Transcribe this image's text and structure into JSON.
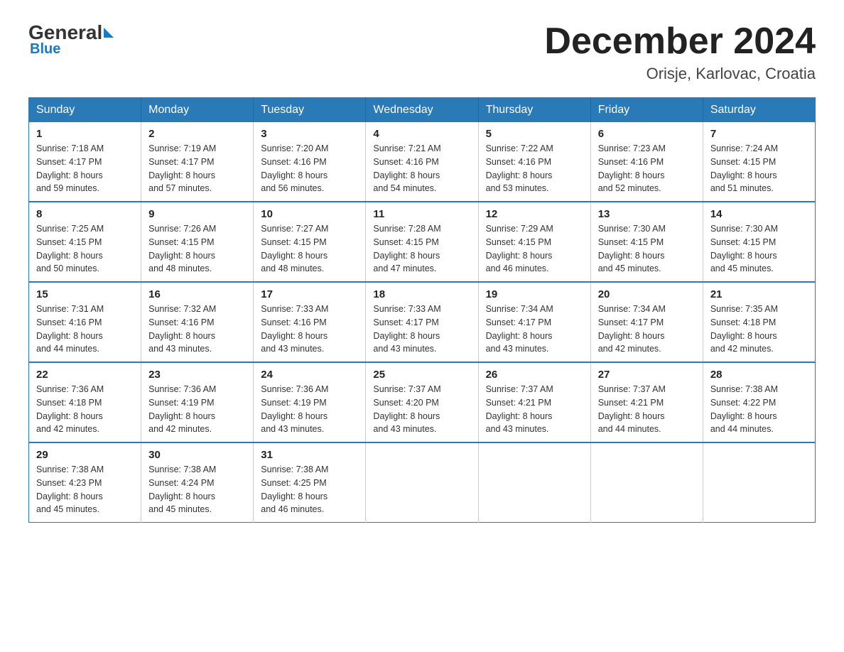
{
  "logo": {
    "general": "General",
    "blue": "Blue"
  },
  "header": {
    "month_year": "December 2024",
    "location": "Orisje, Karlovac, Croatia"
  },
  "weekdays": [
    "Sunday",
    "Monday",
    "Tuesday",
    "Wednesday",
    "Thursday",
    "Friday",
    "Saturday"
  ],
  "weeks": [
    [
      {
        "day": "1",
        "sunrise": "7:18 AM",
        "sunset": "4:17 PM",
        "daylight": "8 hours and 59 minutes."
      },
      {
        "day": "2",
        "sunrise": "7:19 AM",
        "sunset": "4:17 PM",
        "daylight": "8 hours and 57 minutes."
      },
      {
        "day": "3",
        "sunrise": "7:20 AM",
        "sunset": "4:16 PM",
        "daylight": "8 hours and 56 minutes."
      },
      {
        "day": "4",
        "sunrise": "7:21 AM",
        "sunset": "4:16 PM",
        "daylight": "8 hours and 54 minutes."
      },
      {
        "day": "5",
        "sunrise": "7:22 AM",
        "sunset": "4:16 PM",
        "daylight": "8 hours and 53 minutes."
      },
      {
        "day": "6",
        "sunrise": "7:23 AM",
        "sunset": "4:16 PM",
        "daylight": "8 hours and 52 minutes."
      },
      {
        "day": "7",
        "sunrise": "7:24 AM",
        "sunset": "4:15 PM",
        "daylight": "8 hours and 51 minutes."
      }
    ],
    [
      {
        "day": "8",
        "sunrise": "7:25 AM",
        "sunset": "4:15 PM",
        "daylight": "8 hours and 50 minutes."
      },
      {
        "day": "9",
        "sunrise": "7:26 AM",
        "sunset": "4:15 PM",
        "daylight": "8 hours and 48 minutes."
      },
      {
        "day": "10",
        "sunrise": "7:27 AM",
        "sunset": "4:15 PM",
        "daylight": "8 hours and 48 minutes."
      },
      {
        "day": "11",
        "sunrise": "7:28 AM",
        "sunset": "4:15 PM",
        "daylight": "8 hours and 47 minutes."
      },
      {
        "day": "12",
        "sunrise": "7:29 AM",
        "sunset": "4:15 PM",
        "daylight": "8 hours and 46 minutes."
      },
      {
        "day": "13",
        "sunrise": "7:30 AM",
        "sunset": "4:15 PM",
        "daylight": "8 hours and 45 minutes."
      },
      {
        "day": "14",
        "sunrise": "7:30 AM",
        "sunset": "4:15 PM",
        "daylight": "8 hours and 45 minutes."
      }
    ],
    [
      {
        "day": "15",
        "sunrise": "7:31 AM",
        "sunset": "4:16 PM",
        "daylight": "8 hours and 44 minutes."
      },
      {
        "day": "16",
        "sunrise": "7:32 AM",
        "sunset": "4:16 PM",
        "daylight": "8 hours and 43 minutes."
      },
      {
        "day": "17",
        "sunrise": "7:33 AM",
        "sunset": "4:16 PM",
        "daylight": "8 hours and 43 minutes."
      },
      {
        "day": "18",
        "sunrise": "7:33 AM",
        "sunset": "4:17 PM",
        "daylight": "8 hours and 43 minutes."
      },
      {
        "day": "19",
        "sunrise": "7:34 AM",
        "sunset": "4:17 PM",
        "daylight": "8 hours and 43 minutes."
      },
      {
        "day": "20",
        "sunrise": "7:34 AM",
        "sunset": "4:17 PM",
        "daylight": "8 hours and 42 minutes."
      },
      {
        "day": "21",
        "sunrise": "7:35 AM",
        "sunset": "4:18 PM",
        "daylight": "8 hours and 42 minutes."
      }
    ],
    [
      {
        "day": "22",
        "sunrise": "7:36 AM",
        "sunset": "4:18 PM",
        "daylight": "8 hours and 42 minutes."
      },
      {
        "day": "23",
        "sunrise": "7:36 AM",
        "sunset": "4:19 PM",
        "daylight": "8 hours and 42 minutes."
      },
      {
        "day": "24",
        "sunrise": "7:36 AM",
        "sunset": "4:19 PM",
        "daylight": "8 hours and 43 minutes."
      },
      {
        "day": "25",
        "sunrise": "7:37 AM",
        "sunset": "4:20 PM",
        "daylight": "8 hours and 43 minutes."
      },
      {
        "day": "26",
        "sunrise": "7:37 AM",
        "sunset": "4:21 PM",
        "daylight": "8 hours and 43 minutes."
      },
      {
        "day": "27",
        "sunrise": "7:37 AM",
        "sunset": "4:21 PM",
        "daylight": "8 hours and 44 minutes."
      },
      {
        "day": "28",
        "sunrise": "7:38 AM",
        "sunset": "4:22 PM",
        "daylight": "8 hours and 44 minutes."
      }
    ],
    [
      {
        "day": "29",
        "sunrise": "7:38 AM",
        "sunset": "4:23 PM",
        "daylight": "8 hours and 45 minutes."
      },
      {
        "day": "30",
        "sunrise": "7:38 AM",
        "sunset": "4:24 PM",
        "daylight": "8 hours and 45 minutes."
      },
      {
        "day": "31",
        "sunrise": "7:38 AM",
        "sunset": "4:25 PM",
        "daylight": "8 hours and 46 minutes."
      },
      null,
      null,
      null,
      null
    ]
  ],
  "labels": {
    "sunrise": "Sunrise:",
    "sunset": "Sunset:",
    "daylight": "Daylight:"
  }
}
